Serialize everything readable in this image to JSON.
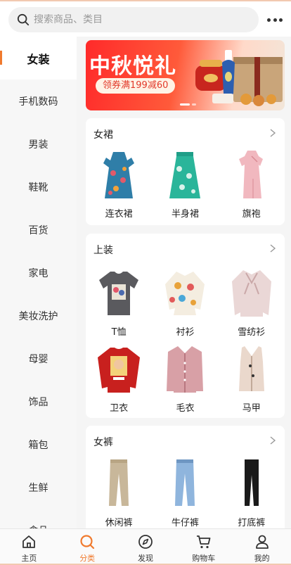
{
  "search": {
    "placeholder": "搜索商品、类目",
    "icon": "search-icon"
  },
  "header": {
    "more_icon": "more-dots-icon"
  },
  "sidebar": {
    "items": [
      {
        "label": "女装",
        "active": true
      },
      {
        "label": "手机数码"
      },
      {
        "label": "男装"
      },
      {
        "label": "鞋靴"
      },
      {
        "label": "百货"
      },
      {
        "label": "家电"
      },
      {
        "label": "美妆洗护"
      },
      {
        "label": "母婴"
      },
      {
        "label": "饰品"
      },
      {
        "label": "箱包"
      },
      {
        "label": "生鲜"
      },
      {
        "label": "食品"
      }
    ]
  },
  "banner": {
    "title": "中秋悦礼",
    "coupon": "领券满199减60"
  },
  "sections": [
    {
      "title": "女裙",
      "items": [
        {
          "label": "连衣裙"
        },
        {
          "label": "半身裙"
        },
        {
          "label": "旗袍"
        }
      ]
    },
    {
      "title": "上装",
      "items": [
        {
          "label": "T恤"
        },
        {
          "label": "衬衫"
        },
        {
          "label": "雪纺衫"
        },
        {
          "label": "卫衣"
        },
        {
          "label": "毛衣"
        },
        {
          "label": "马甲"
        }
      ]
    },
    {
      "title": "女裤",
      "items": [
        {
          "label": "休闲裤"
        },
        {
          "label": "牛仔裤"
        },
        {
          "label": "打底裤"
        }
      ]
    }
  ],
  "tabbar": {
    "items": [
      {
        "label": "主页",
        "icon": "home-icon"
      },
      {
        "label": "分类",
        "icon": "category-icon",
        "active": true
      },
      {
        "label": "发现",
        "icon": "compass-icon"
      },
      {
        "label": "购物车",
        "icon": "cart-icon"
      },
      {
        "label": "我的",
        "icon": "user-icon"
      }
    ]
  },
  "colors": {
    "accent": "#f07a2e",
    "banner_red": "#ff2a2a"
  }
}
